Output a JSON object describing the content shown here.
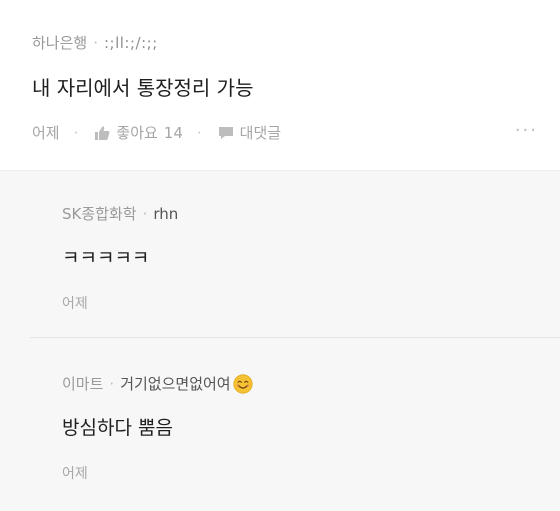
{
  "post": {
    "company": "하나은행",
    "nickname": ":;ll:;/:;;",
    "text": "내 자리에서 통장정리 가능",
    "date": "어제",
    "like_label": "좋아요",
    "like_count": "14",
    "comment_label": "대댓글",
    "more_icon": "ellipsis-icon"
  },
  "comments": [
    {
      "company": "SK종합화학",
      "nickname": "rhn",
      "text": "ㅋㅋㅋㅋㅋ",
      "date": "어제"
    },
    {
      "company": "이마트",
      "nickname": "거기없으면없어여",
      "emoji": "smiling-face-icon",
      "text": "방심하다 뿜음",
      "date": "어제"
    }
  ],
  "colors": {
    "background": "#ffffff",
    "comment_background": "#f7f7f7",
    "meta_text": "#9a9a9a",
    "body_text": "#1f1f1f",
    "emoji_yellow": "#f4c233"
  }
}
